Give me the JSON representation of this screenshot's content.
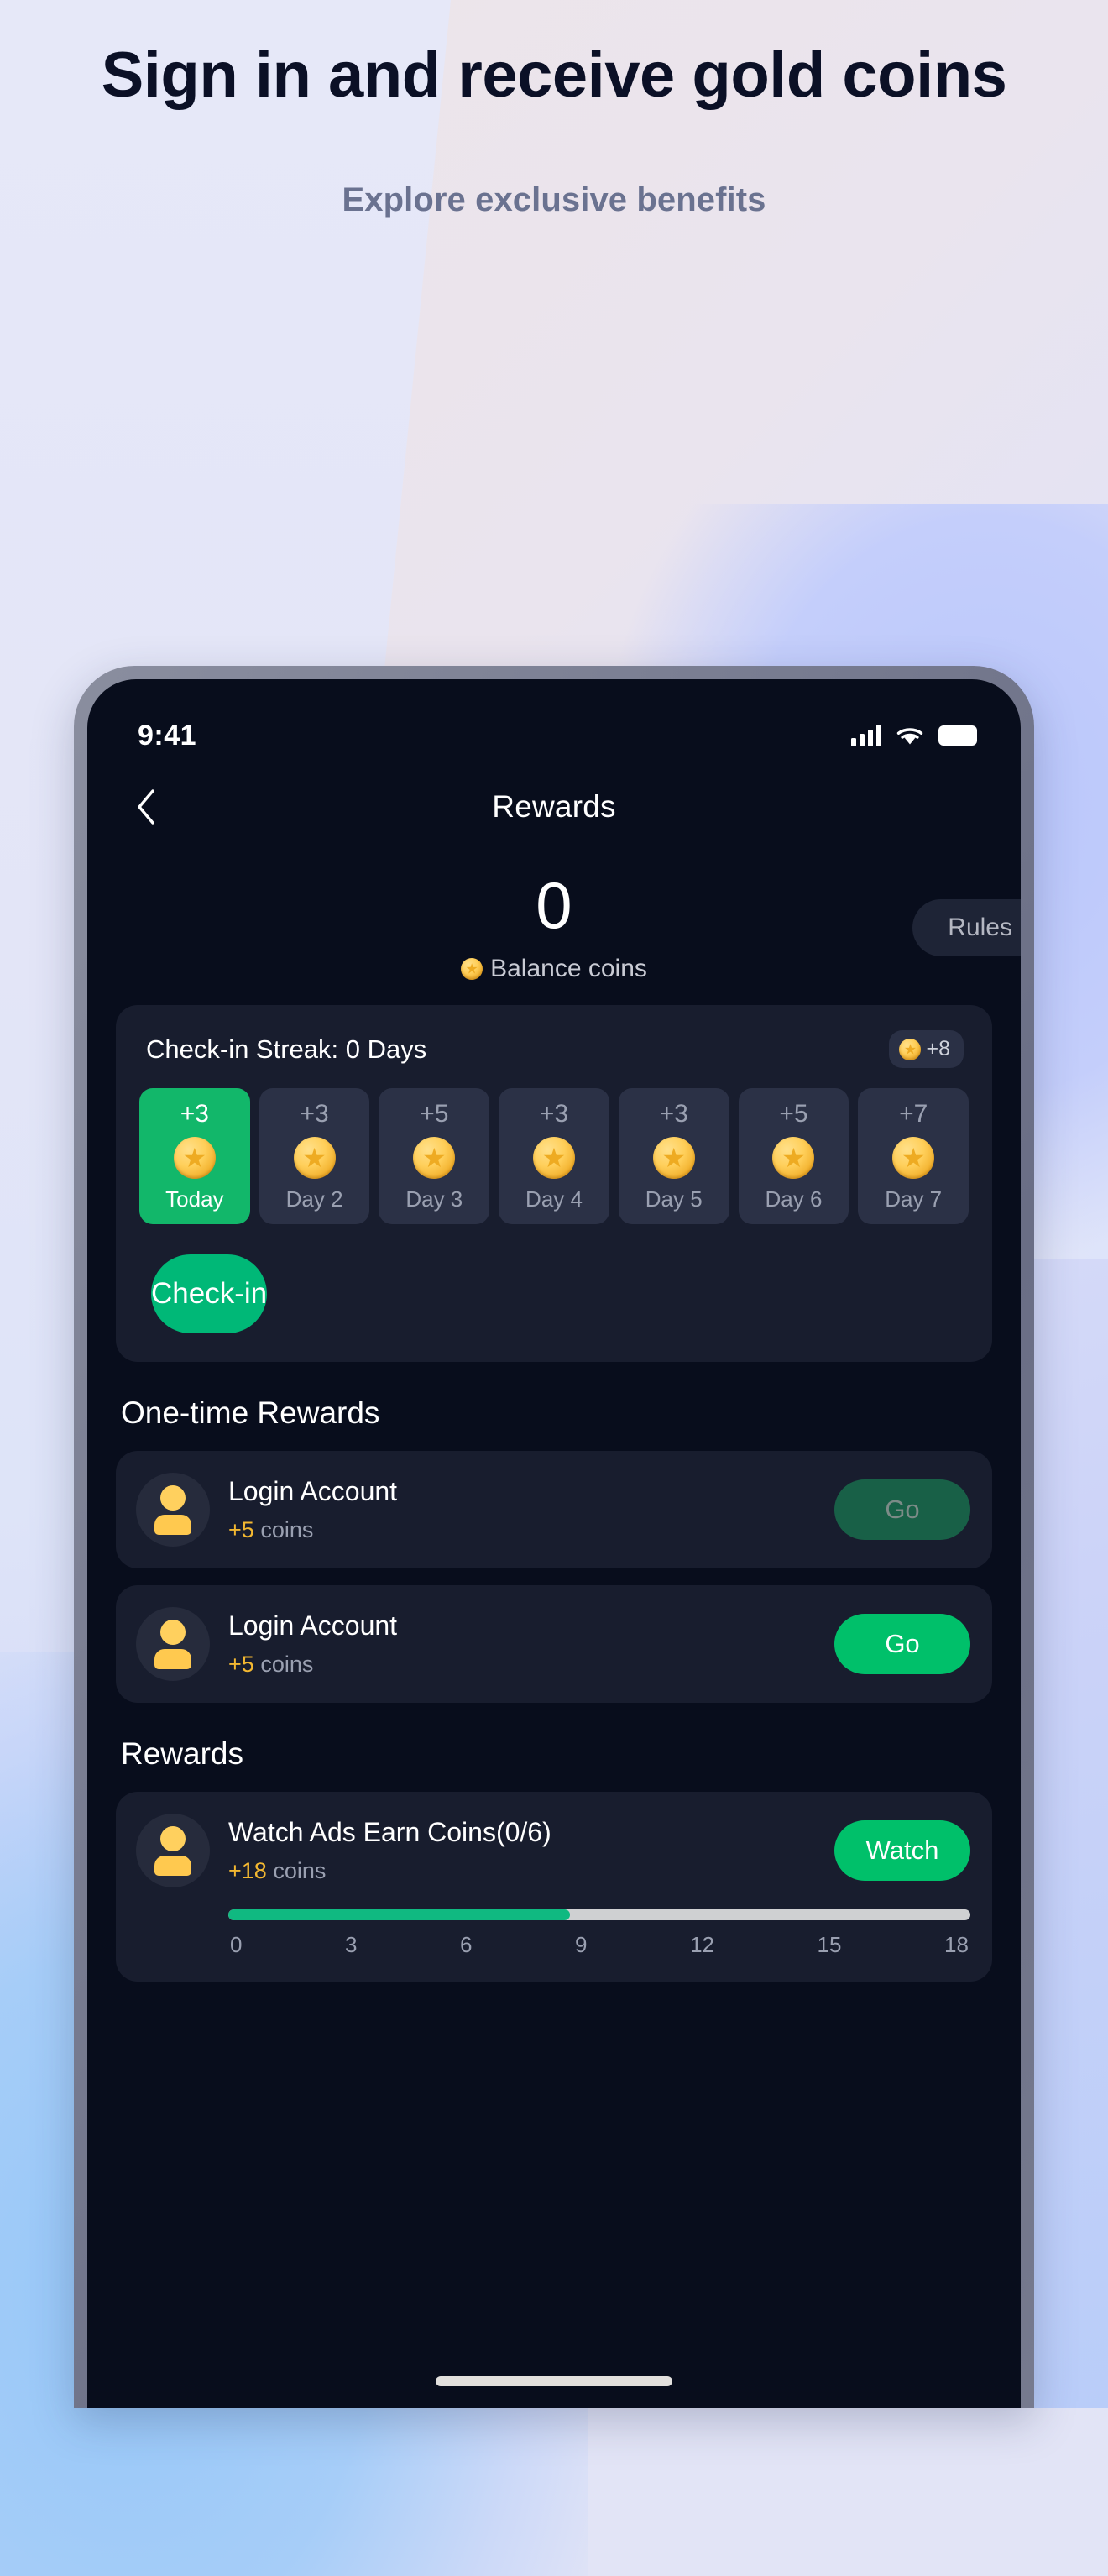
{
  "promo": {
    "headline": "Sign in and receive gold coins",
    "subheadline": "Explore exclusive benefits"
  },
  "colors": {
    "accent_green": "#00b877",
    "active_green": "#12b76a",
    "disabled_green": "#186047",
    "coin_gold": "#ffcf5a",
    "screen_bg": "#080d1c",
    "card_bg": "#181d2e",
    "tile_bg": "#2b3146",
    "headline": "#0b1026",
    "subheadline": "#6a7290"
  },
  "statusbar": {
    "time": "9:41",
    "signal_icon": "cellular-signal-icon",
    "wifi_icon": "wifi-icon",
    "battery_icon": "battery-icon"
  },
  "navbar": {
    "back_icon": "chevron-left-icon",
    "title": "Rewards"
  },
  "balance": {
    "amount": "0",
    "coin_icon": "coin-icon",
    "label": "Balance coins",
    "rules_label": "Rules"
  },
  "checkin": {
    "streak_label": "Check-in Streak:  0 Days",
    "bonus_coin_icon": "coin-icon",
    "bonus_amount": "+8",
    "button_label": "Check-in",
    "days": [
      {
        "amount": "+3",
        "label": "Today",
        "coin_icon": "coin-icon",
        "active": true
      },
      {
        "amount": "+3",
        "label": "Day 2",
        "coin_icon": "coin-icon",
        "active": false
      },
      {
        "amount": "+5",
        "label": "Day 3",
        "coin_icon": "coin-icon",
        "active": false
      },
      {
        "amount": "+3",
        "label": "Day 4",
        "coin_icon": "coin-icon",
        "active": false
      },
      {
        "amount": "+3",
        "label": "Day 5",
        "coin_icon": "coin-icon",
        "active": false
      },
      {
        "amount": "+5",
        "label": "Day 6",
        "coin_icon": "coin-icon",
        "active": false
      },
      {
        "amount": "+7",
        "label": "Day 7",
        "coin_icon": "coin-icon",
        "active": false
      }
    ]
  },
  "one_time_rewards": {
    "section_title": "One-time Rewards",
    "items": [
      {
        "avatar_icon": "user-avatar-icon",
        "name": "Login Account",
        "reward_amount": "+5",
        "reward_unit": "coins",
        "action_label": "Go",
        "state": "disabled"
      },
      {
        "avatar_icon": "user-avatar-icon",
        "name": "Login Account",
        "reward_amount": "+5",
        "reward_unit": "coins",
        "action_label": "Go",
        "state": "active"
      }
    ]
  },
  "rewards": {
    "section_title": "Rewards",
    "ad_task": {
      "avatar_icon": "user-avatar-icon",
      "name": "Watch Ads Earn Coins(0/6)",
      "reward_amount": "+18",
      "reward_unit": "coins",
      "action_label": "Watch",
      "progress_percent": 46,
      "ticks": [
        "0",
        "3",
        "6",
        "9",
        "12",
        "15",
        "18"
      ]
    }
  },
  "home_indicator": "home-indicator"
}
